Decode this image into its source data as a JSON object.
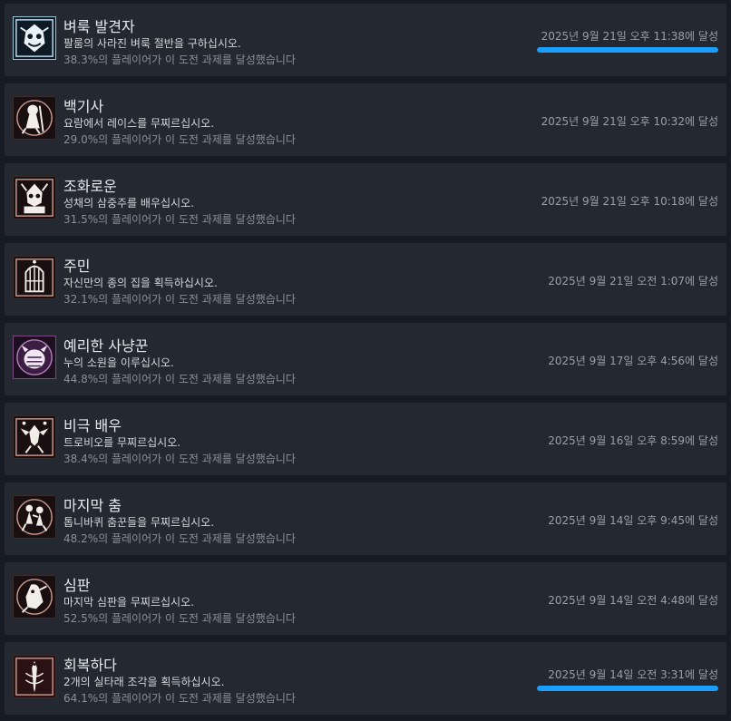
{
  "colors": {
    "background": "#171c24",
    "row_background": "#232831",
    "progress_accent": "#1a9fff"
  },
  "achievements": [
    {
      "icon": "sealed-crest-icon",
      "title": "벼룩 발견자",
      "description": "팔룸의 사라진 벼룩 절반을 구하십시오.",
      "percent": "38.3%의 플레이어가 이 도전 과제를 달성했습니다",
      "date": "2025년 9월 21일 오후 11:38에 달성",
      "progress_fraction": 1.0
    },
    {
      "icon": "white-knight-icon",
      "title": "백기사",
      "description": "요람에서 레이스를 무찌르십시오.",
      "percent": "29.0%의 플레이어가 이 도전 과제를 달성했습니다",
      "date": "2025년 9월 21일 오후 10:32에 달성"
    },
    {
      "icon": "harmony-mask-icon",
      "title": "조화로운",
      "description": "성채의 삼중주를 배우십시오.",
      "percent": "31.5%의 플레이어가 이 도전 과제를 달성했습니다",
      "date": "2025년 9월 21일 오후 10:18에 달성"
    },
    {
      "icon": "cage-house-icon",
      "title": "주민",
      "description": "자신만의 종의 집을 획득하십시오.",
      "percent": "32.1%의 플레이어가 이 도전 과제를 달성했습니다",
      "date": "2025년 9월 21일 오전 1:07에 달성"
    },
    {
      "icon": "hunter-beast-icon",
      "title": "예리한 사냥꾼",
      "description": "누의 소원을 이루십시오.",
      "percent": "44.8%의 플레이어가 이 도전 과제를 달성했습니다",
      "date": "2025년 9월 17일 오후 4:56에 달성"
    },
    {
      "icon": "tragedian-icon",
      "title": "비극 배우",
      "description": "트로비오를 무찌르십시오.",
      "percent": "38.4%의 플레이어가 이 도전 과제를 달성했습니다",
      "date": "2025년 9월 16일 오후 8:59에 달성"
    },
    {
      "icon": "final-dance-icon",
      "title": "마지막 춤",
      "description": "톱니바퀴 춤꾼들을 무찌르십시오.",
      "percent": "48.2%의 플레이어가 이 도전 과제를 달성했습니다",
      "date": "2025년 9월 14일 오후 9:45에 달성"
    },
    {
      "icon": "judge-icon",
      "title": "심판",
      "description": "마지막 심판을 무찌르십시오.",
      "percent": "52.5%의 플레이어가 이 도전 과제를 달성했습니다",
      "date": "2025년 9월 14일 오전 4:48에 달성"
    },
    {
      "icon": "mending-needle-icon",
      "title": "회복하다",
      "description": "2개의 실타래 조각을 획득하십시오.",
      "percent": "64.1%의 플레이어가 이 도전 과제를 달성했습니다",
      "date": "2025년 9월 14일 오전 3:31에 달성",
      "progress_fraction": 1.0
    }
  ]
}
